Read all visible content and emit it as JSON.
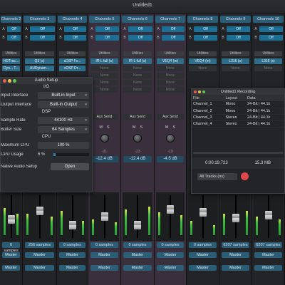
{
  "window": {
    "title": "Untitled1"
  },
  "channels": [
    {
      "name": "Channels 2",
      "a": "Off",
      "b": "Off",
      "util": "Utilities",
      "inserts": [
        "HDTrac...",
        "Dyn... T..."
      ],
      "latency": "0 samples",
      "out1": "Master",
      "out2": "Master"
    },
    {
      "name": "Channels 3",
      "a": "Off",
      "b": "Off",
      "util": "Utilities",
      "inserts": [
        "Q3 (s)",
        "AUDynam..."
      ],
      "latency": "256 samples",
      "out1": "Master",
      "out2": "Master"
    },
    {
      "name": "Channels 4",
      "a": "Off",
      "b": "Off",
      "util": "Utilities",
      "inserts": [
        "cDSP Fx...",
        "cDSP Dr..."
      ],
      "latency": "0 samples",
      "out1": "Master",
      "out2": "Master"
    },
    {
      "name": "Channels 5",
      "a": "Off",
      "b": "Off",
      "util": "Utilities",
      "inserts": [
        "IR-L full (s)",
        "None",
        "None",
        "None",
        "None"
      ],
      "latency": "0 samples",
      "out1": "Master",
      "out2": "Master",
      "send": "Aux Send",
      "ms": [
        "M",
        "S"
      ],
      "knob": "-21",
      "gain": "-12.4 dB"
    },
    {
      "name": "Channels 6",
      "a": "Off",
      "b": "Off",
      "util": "Utilities",
      "inserts": [
        "IR-L full (s)",
        "None",
        "None",
        "None",
        "None"
      ],
      "latency": "0 samples",
      "out1": "Master",
      "out2": "Master",
      "send": "Aux Send",
      "ms": [
        "M",
        "S"
      ],
      "knob": "-23",
      "gain": "-12.4 dB"
    },
    {
      "name": "Channels 7",
      "a": "Off",
      "b": "Off",
      "util": "Utilities",
      "inserts": [
        "VEQ4 (m)",
        "None",
        "None",
        "None",
        "None"
      ],
      "latency": "0 samples",
      "out1": "Master",
      "out2": "Master",
      "send": "Aux Send",
      "ms": [
        "M",
        "S"
      ],
      "knob": "-19",
      "gain": "-4.5 dB"
    },
    {
      "name": "Channels 8",
      "a": "Off",
      "b": "Off",
      "util": "Utilities",
      "inserts": [
        "VEQ4 (m)",
        "None"
      ],
      "latency": "0 samples",
      "out1": "Master",
      "out2": "Master",
      "ms": [
        "M",
        "S"
      ]
    },
    {
      "name": "Channels 9",
      "a": "Off",
      "b": "Off",
      "util": "Utilities",
      "inserts": [
        "L316 (s)",
        "None"
      ],
      "latency": "6207 samples",
      "out1": "Master",
      "out2": "Master"
    },
    {
      "name": "Channels 10",
      "a": "Off",
      "b": "Off",
      "util": "Utilities",
      "inserts": [
        "L316 (s)",
        "None"
      ],
      "latency": "6207 samples",
      "out1": "Master",
      "out2": "Master"
    }
  ],
  "audio_setup": {
    "title": "Audio Setup",
    "section_io": "I/O",
    "input_label": "Input Interface",
    "input_value": "Built-in Input",
    "output_label": "Output Interface",
    "output_value": "Built-in Output",
    "section_dsp": "DSP",
    "rate_label": "Sample Rate",
    "rate_value": "44100 Hz",
    "buffer_label": "Buffer Size",
    "buffer_value": "64 Samples",
    "section_cpu": "CPU",
    "maxcpu_label": "Maximum CPU",
    "maxcpu_value": "100 %",
    "usage_label": "CPU Usage",
    "usage_value": "6 %",
    "usage_fraction": 0.06,
    "native_label": "Native Audio Setup",
    "native_button": "Open"
  },
  "recording": {
    "title": "Untitled1 Recording",
    "columns": [
      "File",
      "Layout",
      "Data"
    ],
    "rows": [
      {
        "file": "Channel_1",
        "layout": "Mono",
        "data": "24-Bit | 44.1k"
      },
      {
        "file": "Channel_2",
        "layout": "Mono",
        "data": "24-Bit | 44.1k"
      },
      {
        "file": "Channel_3",
        "layout": "Stereo",
        "data": "24-Bit | 44.1k"
      },
      {
        "file": "Channel_4",
        "layout": "Stereo",
        "data": "24-Bit | 44.1k"
      }
    ],
    "time": "0:00:19.723",
    "size": "15.3 MB",
    "tracks_select": "All Tracks (ns)"
  }
}
